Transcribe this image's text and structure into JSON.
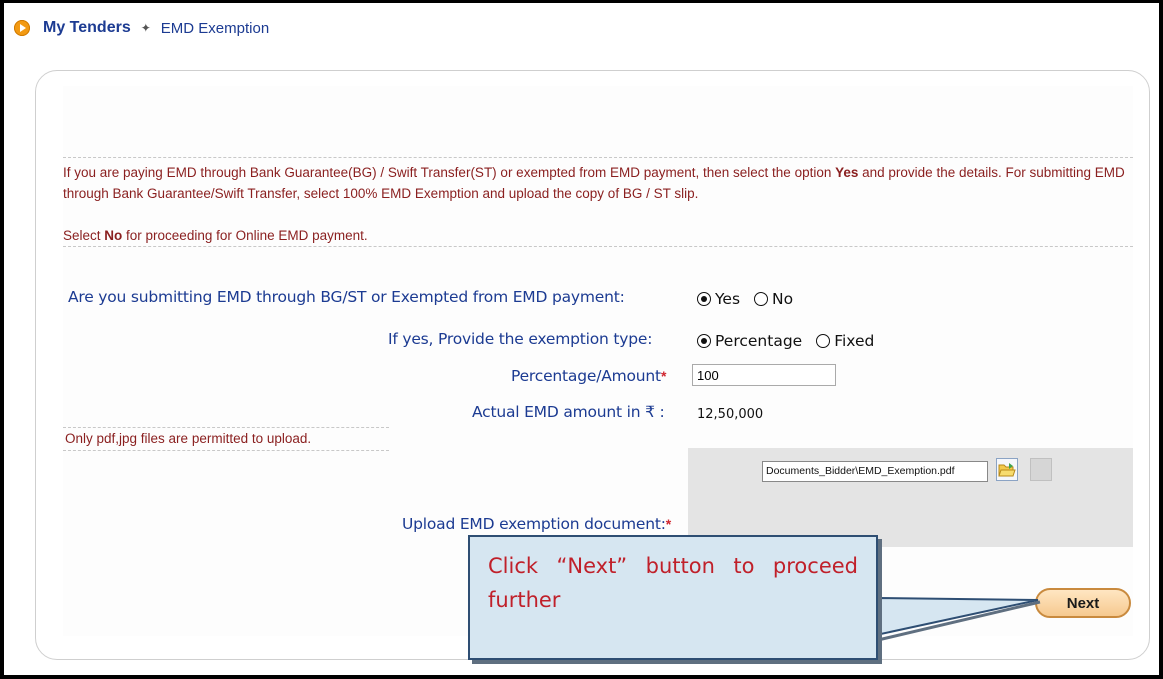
{
  "breadcrumb": {
    "main": "My Tenders",
    "separator": "→",
    "current": "EMD Exemption"
  },
  "notice": {
    "line1_pre": "If you are paying EMD through Bank Guarantee(BG) / Swift Transfer(ST) or exempted from EMD payment, then select the option ",
    "line1_bold": "Yes",
    "line1_post": " and provide the details. For submitting EMD through Bank Guarantee/Swift Transfer, select 100% EMD Exemption and upload the copy of BG / ST slip.",
    "line2_pre": "Select ",
    "line2_bold": "No",
    "line2_post": " for proceeding for Online EMD payment."
  },
  "form": {
    "emd_question": "Are you submitting EMD through BG/ST or Exempted from EMD payment:",
    "emd_options": [
      "Yes",
      "No"
    ],
    "emd_selected": "Yes",
    "exemption_type_label": "If yes, Provide the exemption type:",
    "exemption_options": [
      "Percentage",
      "Fixed"
    ],
    "exemption_selected": "Percentage",
    "amount_label": "Percentage/Amount",
    "amount_required": "*",
    "amount_value": "100",
    "actual_emd_label": "Actual EMD amount in ₹ :",
    "actual_emd_value": "12,50,000",
    "permit_note": "Only pdf,jpg files are permitted to upload.",
    "upload_label": "Upload EMD exemption document:",
    "upload_required": "*",
    "upload_file": "Documents_Bidder\\EMD_Exemption.pdf"
  },
  "buttons": {
    "next": "Next"
  },
  "callout": {
    "text": "Click “Next” button to proceed further"
  },
  "colors": {
    "label_blue": "#1c3b92",
    "notice_red": "#8a1f1f",
    "callout_red": "#c0202a",
    "callout_bg": "#d6e6f1",
    "next_orange": "#f6c98f"
  }
}
